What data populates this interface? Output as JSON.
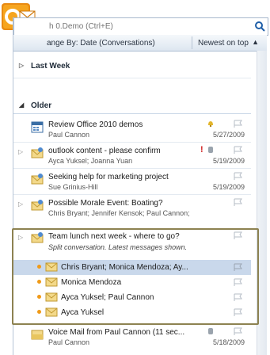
{
  "search": {
    "placeholder": "h 0.Demo (Ctrl+E)",
    "icon": "search-icon"
  },
  "arrange": {
    "by_label": "ange By: Date (Conversations)",
    "order_label": "Newest on top"
  },
  "groups": [
    {
      "label": "Last Week",
      "state": "collapsed"
    },
    {
      "label": "Older",
      "state": "expanded"
    }
  ],
  "messages": [
    {
      "subject": "Review Office 2010 demos",
      "from": "Paul Cannon",
      "date": "5/27/2009",
      "icon": "calendar-icon"
    },
    {
      "subject": "outlook content - please confirm",
      "from": "Ayca Yuksel; Joanna Yuan",
      "date": "5/19/2009",
      "icon": "envelope-icon",
      "important": "!"
    },
    {
      "subject": "Seeking help for marketing project",
      "from": "Sue Grinius-Hill",
      "date": "5/19/2009",
      "icon": "envelope-icon"
    },
    {
      "subject": "Possible Morale Event: Boating?",
      "from": "Chris Bryant; Jennifer Kensok; Paul Cannon;",
      "date": "",
      "icon": "envelope-icon"
    }
  ],
  "conversation": {
    "subject": "Team lunch next week - where to go?",
    "note": "Split conversation. Latest messages shown.",
    "children": [
      {
        "name": "Chris Bryant; Monica Mendoza; Ay..."
      },
      {
        "name": "Monica Mendoza"
      },
      {
        "name": "Ayca Yuksel; Paul Cannon"
      },
      {
        "name": "Ayca Yuksel"
      }
    ]
  },
  "voicemail": {
    "subject": "Voice Mail from Paul Cannon (11 sec...",
    "from": "Paul Cannon",
    "date": "5/18/2009"
  },
  "colors": {
    "accent": "#f09a18",
    "selection": "#c9d8eb",
    "highlight_border": "#8d8251",
    "header_bg": "#dde6f0"
  }
}
